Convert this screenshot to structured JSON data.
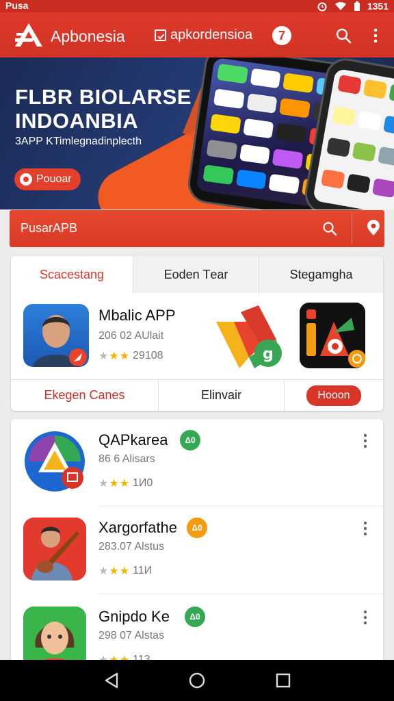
{
  "status_bar": {
    "carrier": "Pusa",
    "time": "1351"
  },
  "app_bar": {
    "brand": "Apbonesia",
    "url_text": "apkordensioa",
    "badge": "7"
  },
  "banner": {
    "title_line1": "FLBR BIOLARSE",
    "title_line2": "INDOANBIA",
    "subtitle": "3APP KTimlegnadinplecth",
    "button_label": "Pouoar"
  },
  "search": {
    "text": "PusarAPB"
  },
  "featured": {
    "tabs": [
      "Scacestang",
      "Eoden Tеar",
      "Stegamgha"
    ],
    "active_tab": 0,
    "app": {
      "title": "Mbalic APP",
      "subtitle": "206 02 AUlait",
      "rating_text": "29108",
      "stars": 3
    },
    "actions": [
      "Ekegen Canes",
      "Elinvair",
      "Hooon"
    ]
  },
  "list": [
    {
      "name": "QAPkarea",
      "size": "86 6 Alisars",
      "rating_text": "1И0",
      "stars": 3,
      "tag": "Δ0",
      "tag_color": "#34a853"
    },
    {
      "name": "Xargorfathe",
      "size": "283.07 Alstus",
      "rating_text": "11И",
      "stars": 3,
      "tag": "Δ0",
      "tag_color": "#f39c12"
    },
    {
      "name": "Gnipdo Ke",
      "size": "298 07 Alstas",
      "rating_text": "113",
      "stars": 3,
      "tag": "Δ0",
      "tag_color": "#34a853"
    }
  ],
  "colors": {
    "primary": "#d9342a",
    "banner_bg": "#1c2b56",
    "accent_orange": "#f15a22"
  }
}
